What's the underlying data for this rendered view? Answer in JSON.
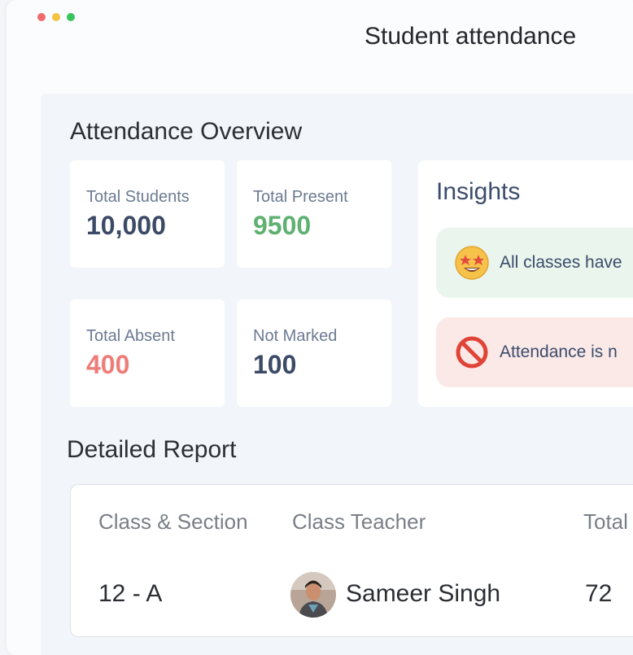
{
  "window": {
    "title": "Student attendance"
  },
  "overview": {
    "title": "Attendance Overview",
    "stats": [
      {
        "label": "Total Students",
        "value": "10,000",
        "color": "#3b4a66"
      },
      {
        "label": "Total Present",
        "value": "9500",
        "color": "#5fb071"
      },
      {
        "label": "Total Absent",
        "value": "400",
        "color": "#ee7c78"
      },
      {
        "label": "Not Marked",
        "value": "100",
        "color": "#3b4a66"
      }
    ]
  },
  "insights": {
    "title": "Insights",
    "items": [
      {
        "icon": "star-struck-emoji-icon",
        "text": "All classes have",
        "status": "positive",
        "bg": "#eaf5ee"
      },
      {
        "icon": "prohibited-icon",
        "text": "Attendance is n",
        "status": "negative",
        "bg": "#fbe9e8"
      }
    ]
  },
  "report": {
    "title": "Detailed Report",
    "columns": [
      "Class & Section",
      "Class Teacher",
      "Total"
    ],
    "rows": [
      {
        "class_section": "12 - A",
        "teacher": "Sameer Singh",
        "total": "72"
      }
    ]
  },
  "colors": {
    "window_dot_red": "#ef6b6b",
    "window_dot_yellow": "#f5c242",
    "window_dot_green": "#37c45a"
  }
}
